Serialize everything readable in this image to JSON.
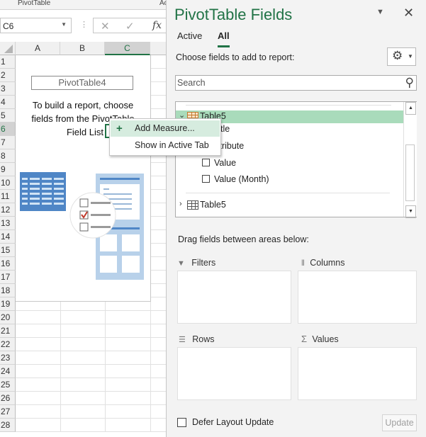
{
  "ribbon": {
    "tab1": "PivotTable",
    "tab2": "Ac"
  },
  "formula_bar": {
    "name_box": "C6",
    "cancel_glyph": "✕",
    "enter_glyph": "✓",
    "fx_glyph": "fx"
  },
  "sheet": {
    "columns": [
      "A",
      "B",
      "C"
    ],
    "selected_column": "C",
    "rows": [
      "1",
      "2",
      "3",
      "4",
      "5",
      "6",
      "7",
      "8",
      "9",
      "10",
      "11",
      "12",
      "13",
      "14",
      "15",
      "16",
      "17",
      "18",
      "19",
      "20",
      "21",
      "22",
      "23",
      "24",
      "25",
      "26",
      "27",
      "28"
    ],
    "selected_row": "6",
    "pivot_placeholder": {
      "name": "PivotTable4",
      "line1": "To build a report, choose",
      "line2": "fields from the PivotTable",
      "line3": "Field List"
    }
  },
  "context_menu": {
    "items": [
      {
        "label": "Add Measure...",
        "icon": "plus-icon",
        "highlighted": true
      },
      {
        "label": "Show in Active Tab",
        "highlighted": false
      }
    ]
  },
  "pane": {
    "title": "PivotTable Fields",
    "tabs": [
      {
        "label": "Active",
        "active": false
      },
      {
        "label": "All",
        "active": true
      }
    ],
    "choose_label": "Choose fields to add to report:",
    "search_placeholder": "Search",
    "fields": {
      "group1": {
        "label": "Table5",
        "expanded": true
      },
      "row_title_partial": "tle",
      "row_attr_partial": "ttribute",
      "items": [
        {
          "label": "Value",
          "checked": false
        },
        {
          "label": "Value (Month)",
          "checked": false
        }
      ],
      "group2": {
        "label": "Table5",
        "expanded": false
      }
    },
    "drag_label": "Drag fields between areas below:",
    "areas": {
      "filters": "Filters",
      "columns": "Columns",
      "rows": "Rows",
      "values": "Values"
    },
    "defer_label": "Defer Layout Update",
    "update_button": "Update",
    "accent_color": "#217346"
  }
}
